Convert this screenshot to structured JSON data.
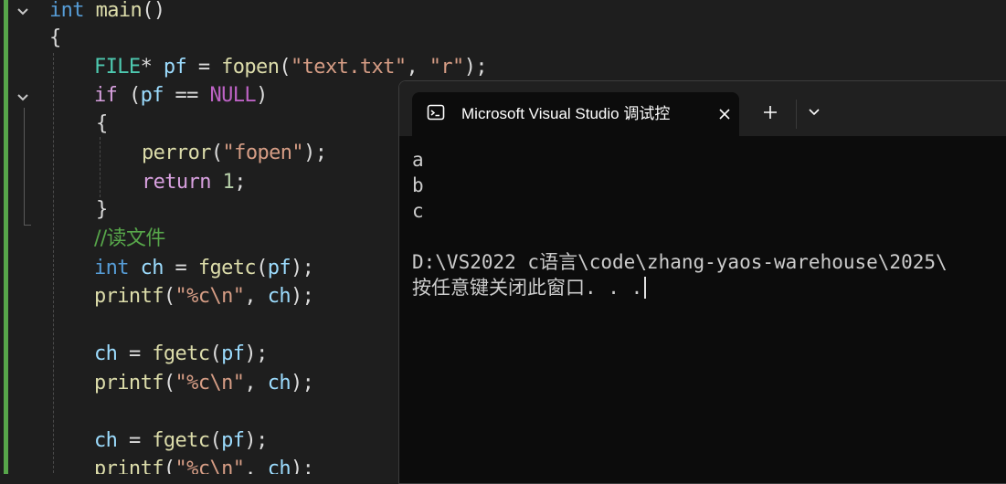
{
  "editor": {
    "lines": {
      "l1": {
        "kw": "int",
        "fn": "main",
        "pun": "()"
      },
      "l2": {
        "pun": "{"
      },
      "l3": {
        "ty": "FILE",
        "p1": "* ",
        "var": "pf",
        "p2": " = ",
        "fn": "fopen",
        "p3": "(",
        "s1": "\"text.txt\"",
        "p4": ", ",
        "s2": "\"r\"",
        "p5": ");"
      },
      "l4": {
        "ctl": "if",
        "p1": " (",
        "var": "pf",
        "p2": " == ",
        "mac": "NULL",
        "p3": ")"
      },
      "l5": {
        "pun": "{"
      },
      "l6": {
        "fn": "perror",
        "p1": "(",
        "s1": "\"fopen\"",
        "p2": ");"
      },
      "l7": {
        "ctl": "return",
        "p1": " ",
        "num": "1",
        "p2": ";"
      },
      "l8": {
        "pun": "}"
      },
      "l9": {
        "cmt": "//读文件"
      },
      "l10": {
        "kw": "int",
        "p1": " ",
        "var": "ch",
        "p2": " = ",
        "fn": "fgetc",
        "p3": "(",
        "var2": "pf",
        "p4": ");"
      },
      "l11": {
        "fn": "printf",
        "p1": "(",
        "s1": "\"%c\\n\"",
        "p2": ", ",
        "var": "ch",
        "p3": ");"
      },
      "l13": {
        "var": "ch",
        "p1": " = ",
        "fn": "fgetc",
        "p2": "(",
        "var2": "pf",
        "p3": ");"
      },
      "l14": {
        "fn": "printf",
        "p1": "(",
        "s1": "\"%c\\n\"",
        "p2": ", ",
        "var": "ch",
        "p3": ");"
      },
      "l16": {
        "var": "ch",
        "p1": " = ",
        "fn": "fgetc",
        "p2": "(",
        "var2": "pf",
        "p3": ");"
      },
      "l17": {
        "fn": "printf",
        "p1": "(",
        "s1": "\"%c\\n\"",
        "p2": ", ",
        "var": "ch",
        "p3": ");"
      }
    }
  },
  "terminal": {
    "tab_title": "Microsoft Visual Studio 调试控",
    "tab_icon": "terminal-icon",
    "close_icon": "close-icon",
    "new_tab_icon": "plus-icon",
    "dropdown_icon": "chevron-down-icon",
    "output": [
      "a",
      "b",
      "c",
      "",
      "D:\\VS2022 c语言\\code\\zhang-yaos-warehouse\\2025\\",
      "按任意键关闭此窗口. . ."
    ]
  },
  "colors": {
    "editor_bg": "#1e1e1e",
    "terminal_bg": "#0c0c0c",
    "change_bar": "#57a64a",
    "keyword": "#569cd6",
    "function": "#dcdcaa",
    "string": "#d69d85",
    "comment": "#57a64a"
  }
}
